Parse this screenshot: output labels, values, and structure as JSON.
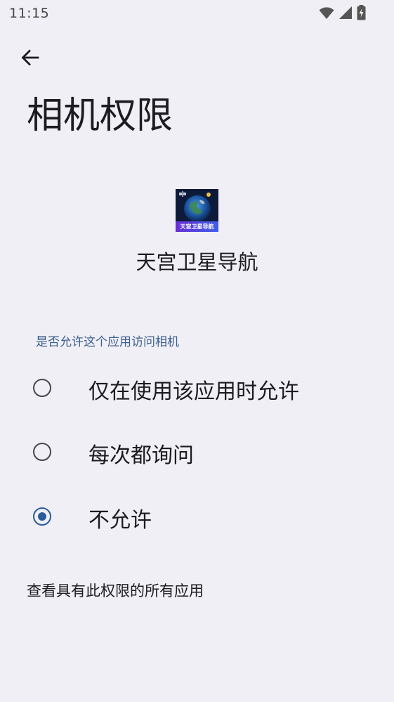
{
  "status_bar": {
    "time": "11:15",
    "icons": [
      "wifi-icon",
      "cellular-signal-icon",
      "battery-charging-icon"
    ]
  },
  "header": {
    "back_icon": "arrow-left-icon",
    "title": "相机权限"
  },
  "app": {
    "name": "天宫卫星导航",
    "icon_banner_text": "天宫卫星导航"
  },
  "permission": {
    "question": "是否允许这个应用访问相机",
    "options": [
      {
        "label": "仅在使用该应用时允许",
        "selected": false
      },
      {
        "label": "每次都询问",
        "selected": false
      },
      {
        "label": "不允许",
        "selected": true
      }
    ]
  },
  "footer": {
    "link_label": "查看具有此权限的所有应用"
  },
  "colors": {
    "background": "#f0eff5",
    "accent": "#2a5c9a",
    "section_header": "#3b5f8f"
  }
}
